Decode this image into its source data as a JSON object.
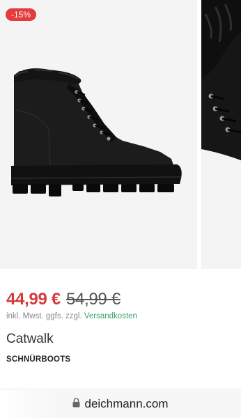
{
  "product": {
    "discount_badge": "-15%",
    "price_current": "44,99 €",
    "price_old": "54,99 €",
    "vat_prefix": "inkl. Mwst. ggfs. zzgl. ",
    "vat_link": "Versandkosten",
    "brand": "Catwalk",
    "category": "SCHNÜRBOOTS"
  },
  "browser": {
    "url": "deichmann.com"
  },
  "colors": {
    "sale": "#e23c3c",
    "link": "#3aa36a",
    "image_bg": "#f4f4f4"
  },
  "icons": [
    "lock-icon"
  ]
}
